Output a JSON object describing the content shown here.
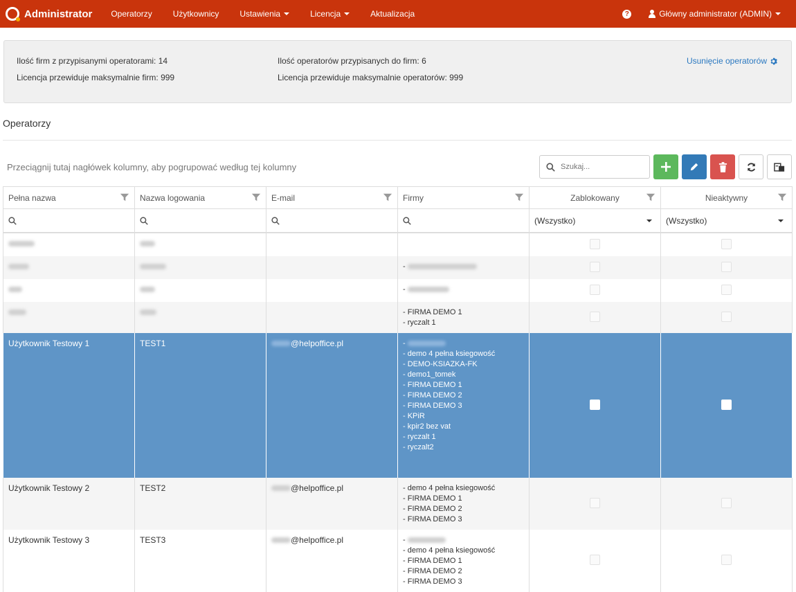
{
  "nav": {
    "brand": "Administrator",
    "items": [
      "Operatorzy",
      "Użytkownicy",
      "Ustawienia",
      "Licencja",
      "Aktualizacja"
    ],
    "user": "Główny administrator (ADMIN)"
  },
  "info": {
    "firms_with_operators": "Ilość firm z przypisanymi operatorami: 14",
    "operators_assigned": "Ilość operatorów przypisanych do firm: 6",
    "license_max_firms": "Licencja przewiduje maksymalnie firm: 999",
    "license_max_operators": "Licencja przewiduje maksymalnie operatorów: 999",
    "remove_link": "Usunięcie operatorów"
  },
  "section_title": "Operatorzy",
  "toolbar": {
    "group_hint": "Przeciągnij tutaj nagłówek kolumny, aby pogrupować według tej kolumny",
    "search_placeholder": "Szukaj..."
  },
  "grid": {
    "columns": [
      "Pełna nazwa",
      "Nazwa logowania",
      "E-mail",
      "Firmy",
      "Zablokowany",
      "Nieaktywny"
    ],
    "filter_all": "(Wszystko)",
    "rows": [
      {
        "full_name": "",
        "login": "",
        "email": "",
        "firms": [],
        "state": "normal"
      },
      {
        "full_name": "",
        "login": "",
        "email": "",
        "firms": [],
        "state": "alt"
      },
      {
        "full_name": "",
        "login": "",
        "email": "",
        "firms": [],
        "state": "normal"
      },
      {
        "full_name": "",
        "login": "",
        "email": "",
        "firms": [
          "- FIRMA DEMO 1",
          "- ryczalt 1"
        ],
        "state": "alt"
      },
      {
        "full_name": "Użytkownik Testowy 1",
        "login": "TEST1",
        "email": "@helpoffice.pl",
        "firms": [
          "- demo 4 pełna ksiegowość",
          "- DEMO-KSIAZKA-FK",
          "- demo1_tomek",
          "- FIRMA DEMO 1",
          "- FIRMA DEMO 2",
          "- FIRMA DEMO 3",
          "- KPiR",
          "- kpir2 bez vat",
          "- ryczalt 1",
          "- ryczalt2"
        ],
        "state": "selected"
      },
      {
        "full_name": "Użytkownik Testowy 2",
        "login": "TEST2",
        "email": "@helpoffice.pl",
        "firms": [
          "- demo 4 pełna ksiegowość",
          "- FIRMA DEMO 1",
          "- FIRMA DEMO 2",
          "- FIRMA DEMO 3"
        ],
        "state": "alt"
      },
      {
        "full_name": "Użytkownik Testowy 3",
        "login": "TEST3",
        "email": "@helpoffice.pl",
        "firms": [
          "- demo 4 pełna ksiegowość",
          "- FIRMA DEMO 1",
          "- FIRMA DEMO 2",
          "- FIRMA DEMO 3"
        ],
        "state": "normal"
      }
    ]
  }
}
